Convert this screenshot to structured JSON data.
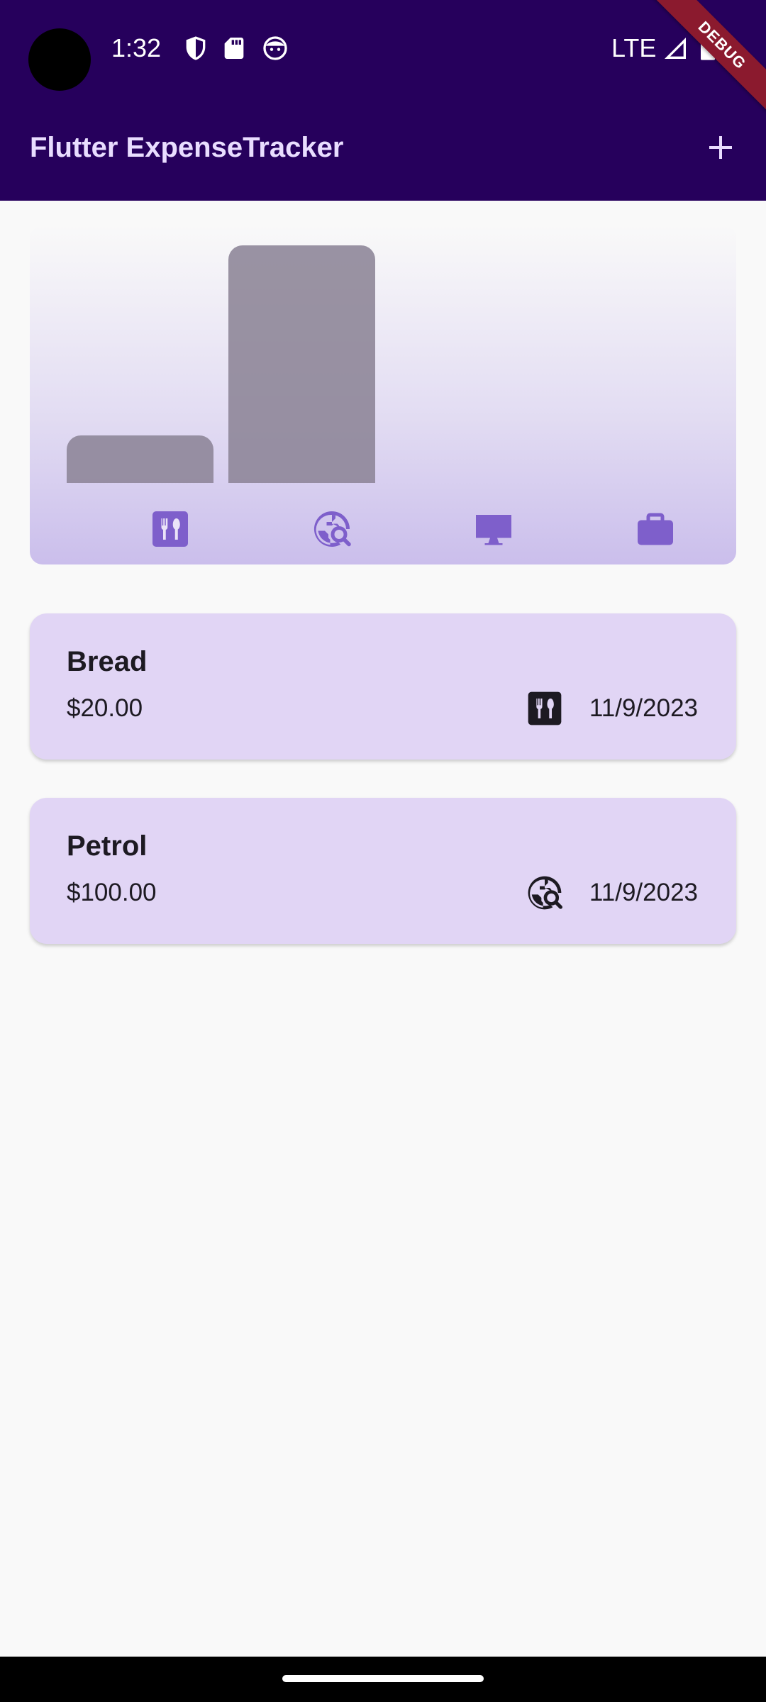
{
  "status_bar": {
    "time": "1:32",
    "network": "LTE",
    "icons": [
      "shield-icon",
      "sd-card-icon",
      "face-icon",
      "signal-icon",
      "battery-icon"
    ]
  },
  "debug_banner": "DEBUG",
  "app_bar": {
    "title": "Flutter ExpenseTracker",
    "add_icon": "plus-icon"
  },
  "chart_data": {
    "type": "bar",
    "categories": [
      "food",
      "travel",
      "leisure",
      "work"
    ],
    "values": [
      20,
      100,
      0,
      0
    ],
    "category_icons": [
      "food-icon",
      "travel-explore-icon",
      "leisure-computer-icon",
      "work-briefcase-icon"
    ]
  },
  "expenses": [
    {
      "title": "Bread",
      "amount": "$20.00",
      "date": "11/9/2023",
      "category_icon": "food-icon"
    },
    {
      "title": "Petrol",
      "amount": "$100.00",
      "date": "11/9/2023",
      "category_icon": "travel-explore-icon"
    }
  ],
  "colors": {
    "app_bar": "#26005c",
    "title": "#e9ddff",
    "card": "#e1d5f5",
    "icon_accent": "#7e5fcb",
    "bar": "#8c8496"
  }
}
